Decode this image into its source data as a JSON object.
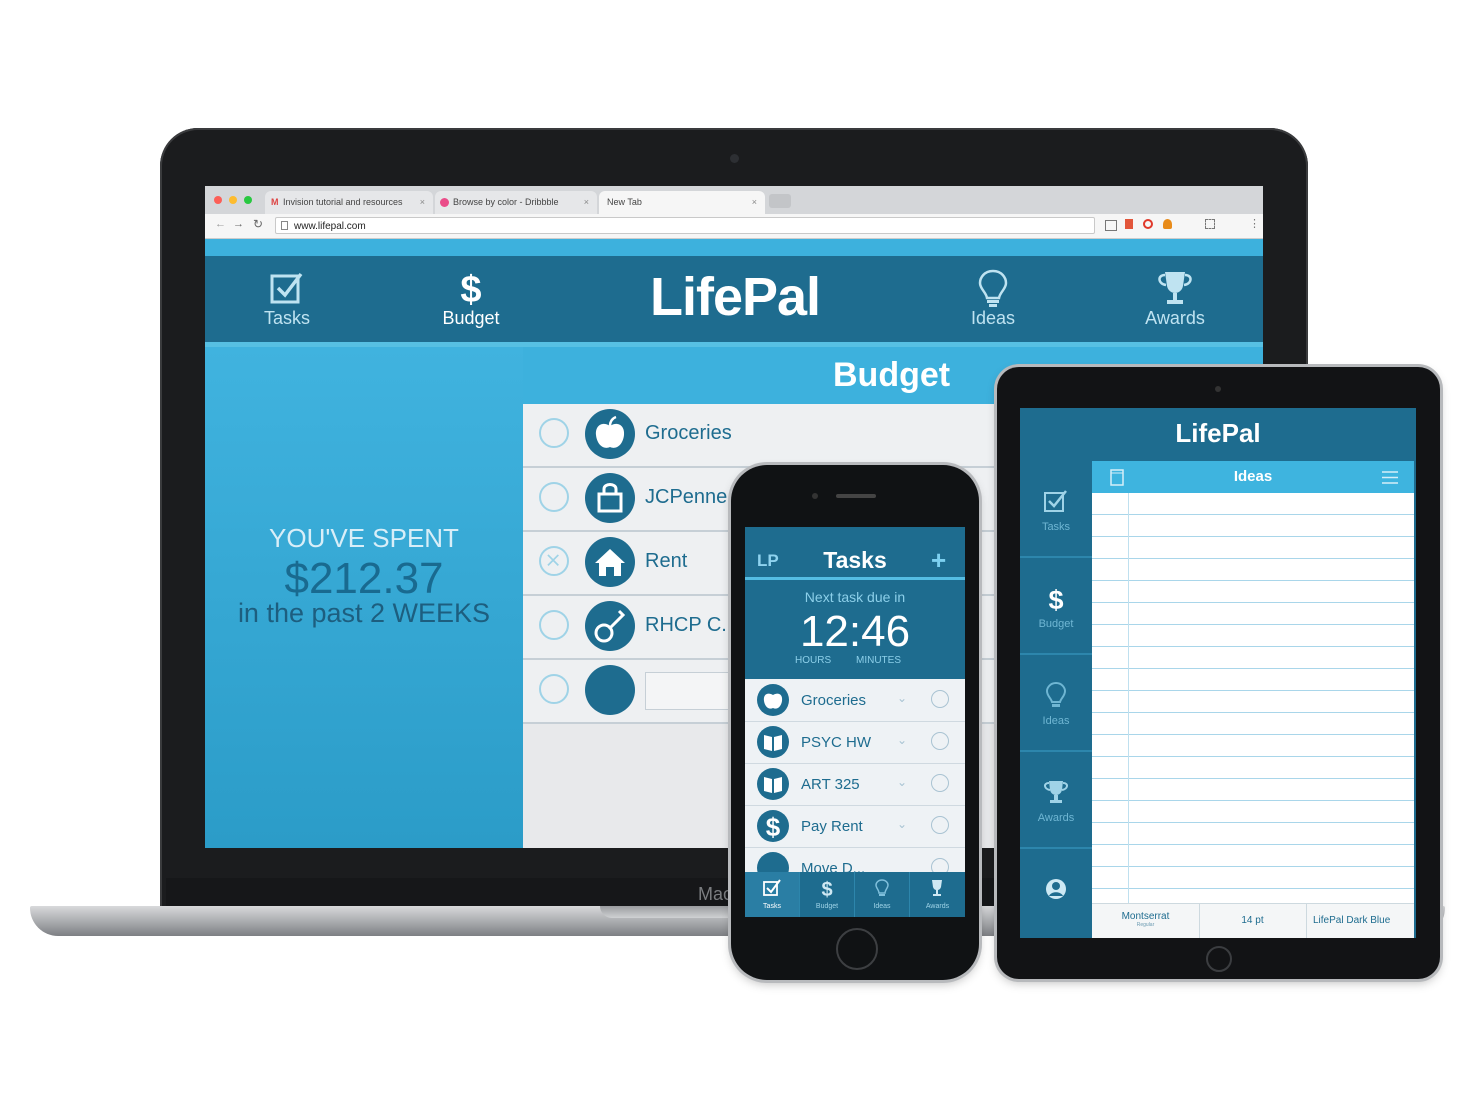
{
  "laptop": {
    "brand_text": "Mac",
    "browser": {
      "tabs": [
        {
          "label": "Invision tutorial and resources"
        },
        {
          "label": "Browse by color - Dribbble"
        },
        {
          "label": "New Tab"
        }
      ],
      "url": "www.lifepal.com"
    },
    "app": {
      "brand": "LifePal",
      "nav": [
        {
          "label": "Tasks",
          "icon": "checkbox-icon"
        },
        {
          "label": "Budget",
          "icon": "dollar-icon"
        },
        {
          "label": "Ideas",
          "icon": "lightbulb-icon"
        },
        {
          "label": "Awards",
          "icon": "trophy-icon"
        }
      ],
      "page_title": "Budget",
      "spent_line1": "YOU'VE SPENT",
      "spent_amount": "$212.37",
      "spent_line3": "in the past  2 WEEKS",
      "budget_items": [
        {
          "label": "Groceries",
          "icon": "apple-icon",
          "checked": false
        },
        {
          "label": "JCPenne",
          "icon": "shopping-bag-icon",
          "checked": false
        },
        {
          "label": "Rent",
          "icon": "house-icon",
          "checked": true
        },
        {
          "label": "RHCP C...",
          "icon": "guitar-icon",
          "checked": false
        },
        {
          "label": "",
          "icon": "blank-icon",
          "checked": false
        }
      ]
    }
  },
  "phone": {
    "logo": "LP",
    "title": "Tasks",
    "add": "+",
    "next_task_label": "Next task due in",
    "countdown": "12:46",
    "hours_label": "HOURS",
    "minutes_label": "MINUTES",
    "tasks": [
      {
        "label": "Groceries",
        "icon": "apple-icon"
      },
      {
        "label": "PSYC HW",
        "icon": "book-icon"
      },
      {
        "label": "ART 325",
        "icon": "book-icon"
      },
      {
        "label": "Pay Rent",
        "icon": "dollar-icon"
      },
      {
        "label": "Move D...",
        "icon": "target-icon"
      }
    ],
    "tabbar": [
      {
        "label": "Tasks"
      },
      {
        "label": "Budget"
      },
      {
        "label": "Ideas"
      },
      {
        "label": "Awards"
      }
    ]
  },
  "tablet": {
    "brand": "LifePal",
    "section": "Ideas",
    "sidebar": [
      {
        "label": "Tasks"
      },
      {
        "label": "Budget"
      },
      {
        "label": "Ideas"
      },
      {
        "label": "Awards"
      },
      {
        "label": ""
      }
    ],
    "footer": {
      "font": "Montserrat",
      "font_style": "Regular",
      "size": "14 pt",
      "color": "LifePal Dark Blue"
    }
  },
  "colors": {
    "dark_blue": "#1e6c8f",
    "light_blue": "#3db1dd"
  }
}
